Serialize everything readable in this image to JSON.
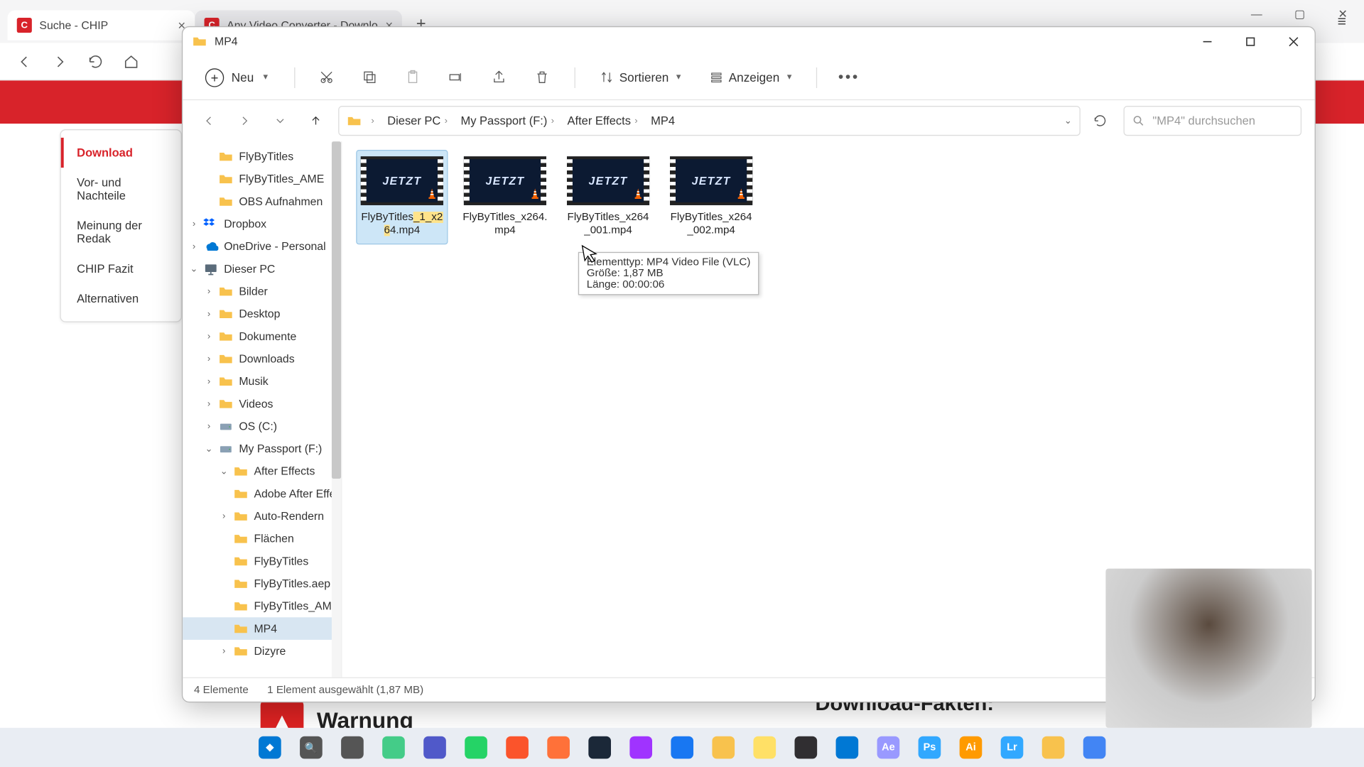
{
  "browser": {
    "tabs": [
      {
        "title": "Suche - CHIP"
      },
      {
        "title": "Any Video Converter - Downlo"
      }
    ],
    "window_controls": {
      "min": "—",
      "max": "▢",
      "close": "✕"
    }
  },
  "website": {
    "sidebar": [
      "Download",
      "Vor- und Nachteile",
      "Meinung der Redak",
      "CHIP Fazit",
      "Alternativen"
    ],
    "warning_label": "Warnung",
    "download_fakten": "Download-Fakten:"
  },
  "explorer": {
    "title": "MP4",
    "cmd": {
      "new": "Neu",
      "sort": "Sortieren",
      "view": "Anzeigen"
    },
    "breadcrumbs": [
      "Dieser PC",
      "My Passport (F:)",
      "After Effects",
      "MP4"
    ],
    "search_placeholder": "\"MP4\" durchsuchen",
    "nav": [
      {
        "label": "FlyByTitles",
        "icon": "folder",
        "level": 2
      },
      {
        "label": "FlyByTitles_AME",
        "icon": "folder",
        "level": 2
      },
      {
        "label": "OBS Aufnahmen",
        "icon": "folder",
        "level": 2
      },
      {
        "label": "Dropbox",
        "icon": "dropbox",
        "level": 1,
        "exp": ">"
      },
      {
        "label": "OneDrive - Personal",
        "icon": "onedrive",
        "level": 1,
        "exp": ">"
      },
      {
        "label": "Dieser PC",
        "icon": "pc",
        "level": 1,
        "exp": "v"
      },
      {
        "label": "Bilder",
        "icon": "folder",
        "level": 2,
        "exp": ">"
      },
      {
        "label": "Desktop",
        "icon": "folder",
        "level": 2,
        "exp": ">"
      },
      {
        "label": "Dokumente",
        "icon": "folder",
        "level": 2,
        "exp": ">"
      },
      {
        "label": "Downloads",
        "icon": "folder",
        "level": 2,
        "exp": ">"
      },
      {
        "label": "Musik",
        "icon": "folder",
        "level": 2,
        "exp": ">"
      },
      {
        "label": "Videos",
        "icon": "folder",
        "level": 2,
        "exp": ">"
      },
      {
        "label": "OS (C:)",
        "icon": "drive",
        "level": 2,
        "exp": ">"
      },
      {
        "label": "My Passport (F:)",
        "icon": "drive",
        "level": 2,
        "exp": "v"
      },
      {
        "label": "After Effects",
        "icon": "folder",
        "level": 3,
        "exp": "v"
      },
      {
        "label": "Adobe After Effec",
        "icon": "folder",
        "level": 3
      },
      {
        "label": "Auto-Rendern",
        "icon": "folder",
        "level": 3,
        "exp": ">"
      },
      {
        "label": "Flächen",
        "icon": "folder",
        "level": 3
      },
      {
        "label": "FlyByTitles",
        "icon": "folder",
        "level": 3
      },
      {
        "label": "FlyByTitles.aep Pro",
        "icon": "folder",
        "level": 3
      },
      {
        "label": "FlyByTitles_AME",
        "icon": "folder",
        "level": 3
      },
      {
        "label": "MP4",
        "icon": "folder",
        "level": 3,
        "sel": true
      },
      {
        "label": "Dizyre",
        "icon": "folder",
        "level": 3,
        "exp": ">"
      }
    ],
    "files": [
      {
        "name": "FlyByTitles_1_x264.mp4",
        "sel": true
      },
      {
        "name": "FlyByTitles_x264.mp4"
      },
      {
        "name": "FlyByTitles_x264_001.mp4"
      },
      {
        "name": "FlyByTitles_x264_002.mp4"
      }
    ],
    "thumb_text": "JETZT",
    "tooltip": {
      "line1": "Elementtyp: MP4 Video File (VLC)",
      "line2": "Größe: 1,87 MB",
      "line3": "Länge: 00:00:06"
    },
    "status": {
      "count": "4 Elemente",
      "selection": "1 Element ausgewählt (1,87 MB)"
    }
  },
  "taskbar_icons": [
    "start",
    "search",
    "taskview",
    "widgets",
    "teams",
    "whatsapp",
    "brave",
    "firefox",
    "steam",
    "messenger",
    "facebook",
    "explorer",
    "stickynotes",
    "obs",
    "vscode",
    "aftereffects",
    "photoshop",
    "illustrator",
    "lightroom",
    "files",
    "earth"
  ]
}
